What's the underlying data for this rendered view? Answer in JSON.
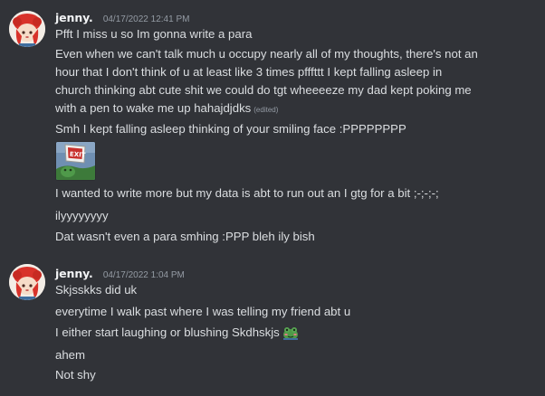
{
  "messages": [
    {
      "author": "jenny.",
      "timestamp": "04/17/2022 12:41 PM",
      "lines": [
        "Pfft I miss u so Im gonna write a para",
        "Even when we can't talk much u occupy nearly all of my thoughts, there's not an",
        "hour that I don't think of u at least like 3 times pfffttt I kept falling asleep in",
        "church thinking abt cute shit we could do tgt wheeeeze my dad kept poking me",
        "with a pen to wake me up hahajdjdks",
        "Smh I kept falling asleep thinking of your smiling face :PPPPPPPP",
        "I wanted to write more but my data is abt to run out an I gtg for a bit ;-;-;-;",
        "ilyyyyyyyy",
        "Dat wasn't even a para smhing :PPP bleh ily bish"
      ],
      "edited_label": "(edited)",
      "attachment_sign_text": "EXIT"
    },
    {
      "author": "jenny.",
      "timestamp": "04/17/2022 1:04 PM",
      "lines": [
        "Skjsskks did uk",
        "everytime I walk past where I was telling my friend abt u",
        "I either start laughing or blushing Skdhskjs",
        "ahem",
        "Not shy"
      ]
    }
  ],
  "colors": {
    "background": "#313338",
    "text": "#dbdee1",
    "author": "#f2f3f5",
    "muted": "#949ba4"
  }
}
